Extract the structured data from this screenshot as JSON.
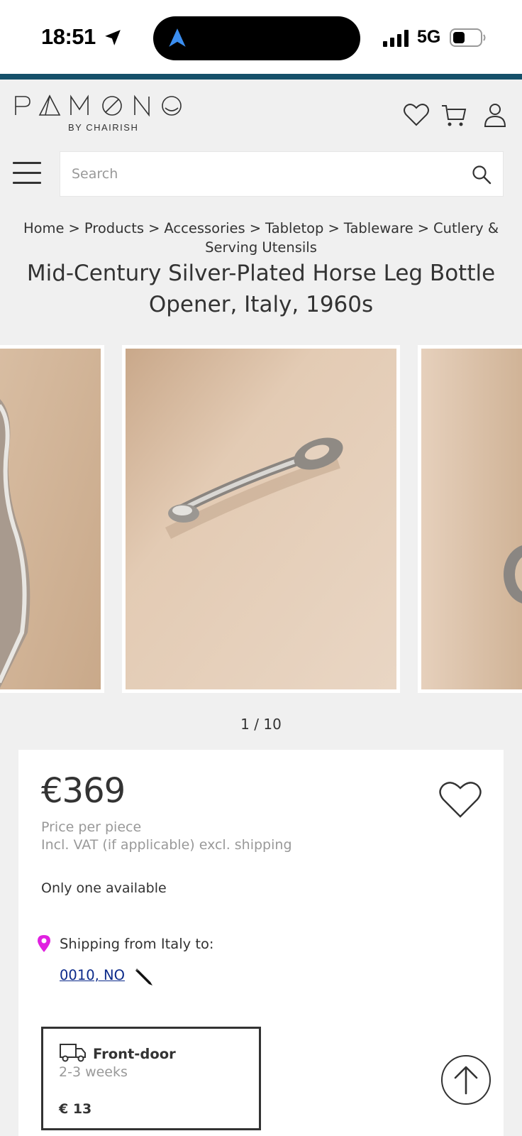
{
  "status_bar": {
    "time": "18:51",
    "network": "5G"
  },
  "header": {
    "logo_text": "PAMONO",
    "logo_sub": "BY CHAIRISH",
    "search_placeholder": "Search"
  },
  "breadcrumbs": [
    "Home",
    "Products",
    "Accessories",
    "Tabletop",
    "Tableware",
    "Cutlery & Serving Utensils"
  ],
  "breadcrumb_separator": ">",
  "product": {
    "title": "Mid-Century Silver-Plated Horse Leg Bottle Opener, Italy, 1960s",
    "image_counter": "1 / 10",
    "price": "€369",
    "price_note": "Price per piece",
    "vat_note": "Incl. VAT (if applicable) excl. shipping",
    "availability": "Only one available",
    "shipping_label": "Shipping from Italy to:",
    "shipping_destination": "0010, NO",
    "delivery": {
      "name": "Front-door",
      "time": "2-3 weeks",
      "price": "€ 13"
    }
  },
  "icons": {
    "status": [
      "location-arrow-icon",
      "navigation-icon",
      "signal-icon",
      "battery-icon"
    ],
    "header": [
      "heart-icon",
      "cart-icon",
      "user-icon",
      "menu-icon",
      "search-icon"
    ],
    "card": [
      "favorite-heart-icon",
      "location-pin-icon",
      "pencil-icon",
      "truck-icon",
      "arrow-up-icon"
    ]
  },
  "colors": {
    "accent_bar": "#15506a",
    "pin": "#e020e0",
    "link": "#0c2a8a",
    "nav_arrow": "#3b8ef0",
    "photo_bg": "#dcc3aa"
  }
}
